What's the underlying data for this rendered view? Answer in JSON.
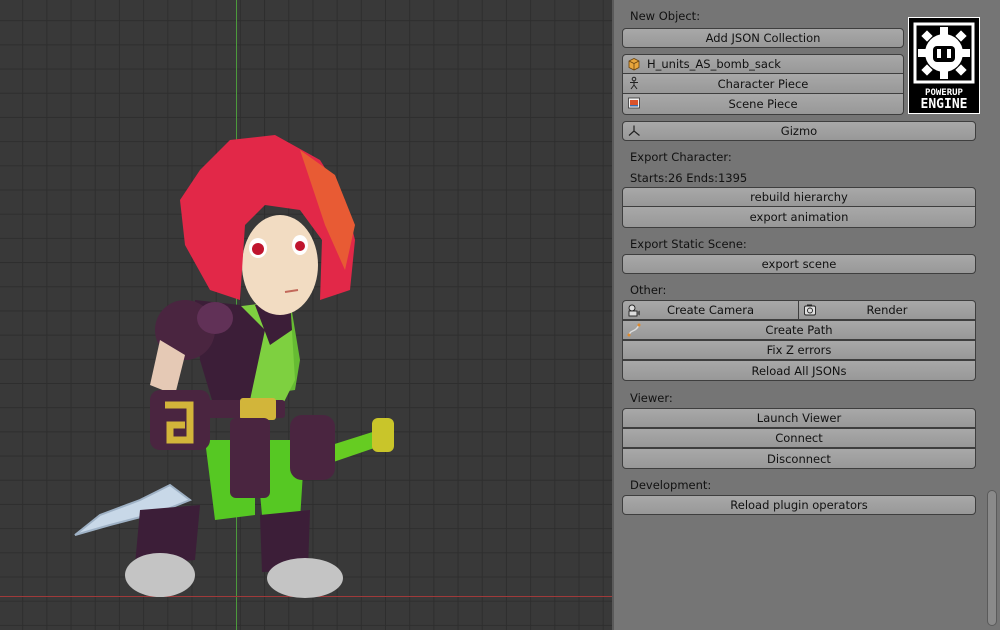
{
  "viewport": {
    "label": "3D viewport"
  },
  "panel": {
    "new_object": {
      "label": "New Object:",
      "add_json_collection": "Add JSON Collection",
      "object_name": "H_units_AS_bomb_sack",
      "character_piece": "Character Piece",
      "scene_piece": "Scene Piece",
      "gizmo": "Gizmo"
    },
    "export_character": {
      "label": "Export Character:",
      "frame_range": "Starts:26 Ends:1395",
      "rebuild_hierarchy": "rebuild hierarchy",
      "export_animation": "export animation"
    },
    "export_static_scene": {
      "label": "Export Static Scene:",
      "export_scene": "export scene"
    },
    "other": {
      "label": "Other:",
      "create_camera": "Create Camera",
      "render": "Render",
      "create_path": "Create Path",
      "fix_z_errors": "Fix Z errors",
      "reload_all_jsons": "Reload All JSONs"
    },
    "viewer": {
      "label": "Viewer:",
      "launch_viewer": "Launch Viewer",
      "connect": "Connect",
      "disconnect": "Disconnect"
    },
    "development": {
      "label": "Development:",
      "reload_plugin_operators": "Reload plugin operators"
    }
  },
  "logo": {
    "line1": "POWERUP",
    "line2": "ENGINE"
  },
  "icons": {
    "object": "package-icon",
    "character": "armature-icon",
    "scene": "image-icon",
    "gizmo": "axes-icon",
    "camera": "camera-icon",
    "render": "render-icon",
    "path": "curve-icon"
  },
  "colors": {
    "panel_bg": "#757575",
    "button_bg": "#a0a0a0",
    "viewport_bg": "#393939",
    "axis_x": "#a03a3a",
    "axis_y": "#4c9a3c"
  }
}
